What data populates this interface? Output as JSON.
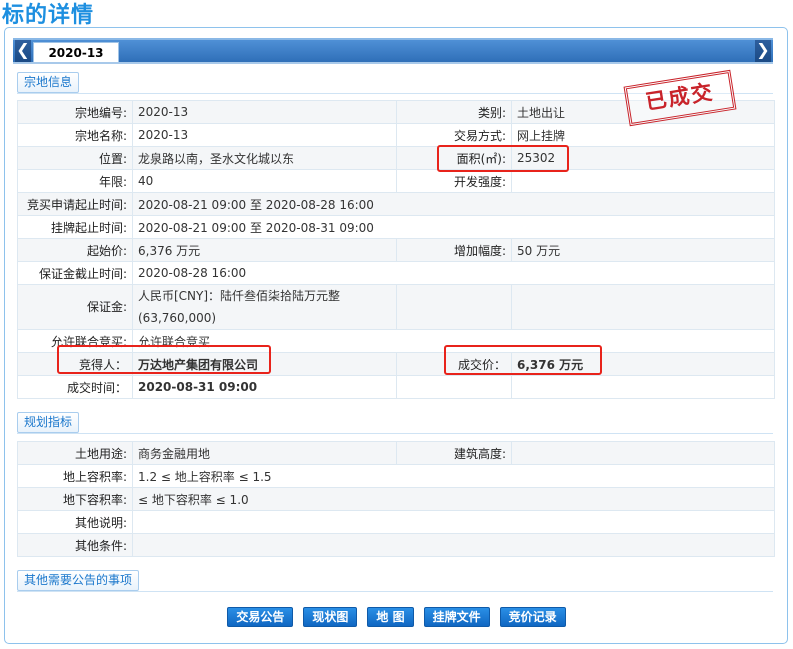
{
  "page_title": "标的详情",
  "tab": {
    "label": "2020-13",
    "prev_glyph": "❮",
    "next_glyph": "❯"
  },
  "stamp_text": "已成交",
  "sections": {
    "parcel_info": "宗地信息",
    "planning": "规划指标",
    "other_notices": "其他需要公告的事项"
  },
  "parcel": {
    "parcel_no_label": "宗地编号:",
    "parcel_no": "2020-13",
    "category_label": "类别:",
    "category": "土地出让",
    "parcel_name_label": "宗地名称:",
    "parcel_name": "2020-13",
    "trade_method_label": "交易方式:",
    "trade_method": "网上挂牌",
    "location_label": "位置:",
    "location": "龙泉路以南，圣水文化城以东",
    "area_label": "面积(㎡):",
    "area": "25302",
    "term_label": "年限:",
    "term": "40",
    "dev_intensity_label": "开发强度:",
    "dev_intensity": "",
    "apply_period_label": "竞买申请起止时间:",
    "apply_period": "2020-08-21 09:00 至 2020-08-28 16:00",
    "listing_period_label": "挂牌起止时间:",
    "listing_period": "2020-08-21 09:00 至 2020-08-31 09:00",
    "start_price_label": "起始价:",
    "start_price": "6,376 万元",
    "increment_label": "增加幅度:",
    "increment": "50 万元",
    "deposit_deadline_label": "保证金截止时间:",
    "deposit_deadline": "2020-08-28 16:00",
    "deposit_label": "保证金:",
    "deposit_line1": "人民币[CNY]：陆仟叁佰柒拾陆万元整",
    "deposit_line2": "(63,760,000)",
    "joint_bid_label": "允许联合竞买:",
    "joint_bid": "允许联合竞买",
    "winner_label": "竞得人：",
    "winner": "万达地产集团有限公司",
    "deal_price_label": "成交价：",
    "deal_price": "6,376 万元",
    "deal_time_label": "成交时间：",
    "deal_time": "2020-08-31 09:00"
  },
  "planning": {
    "land_use_label": "土地用途:",
    "land_use": "商务金融用地",
    "building_height_label": "建筑高度:",
    "building_height": "",
    "far_above_label": "地上容积率:",
    "far_above": "1.2 ≤ 地上容积率 ≤ 1.5",
    "far_below_label": "地下容积率:",
    "far_below": "≤ 地下容积率 ≤ 1.0",
    "other_notes_label": "其他说明:",
    "other_notes": "",
    "other_conditions_label": "其他条件:",
    "other_conditions": ""
  },
  "actions": {
    "announcement": "交易公告",
    "status_map": "现状图",
    "map": "地 图",
    "listing_docs": "挂牌文件",
    "bid_records": "竞价记录"
  }
}
